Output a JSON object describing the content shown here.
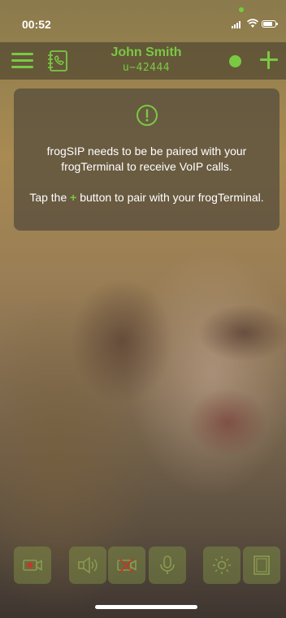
{
  "status_bar": {
    "time": "00:52"
  },
  "header": {
    "user_name": "John Smith",
    "user_id": "u−42444"
  },
  "notice": {
    "line1": "frogSIP needs to be be paired with your frogTerminal to receive VoIP calls.",
    "line2_before": "Tap the",
    "line2_plus": "+",
    "line2_after": "button to pair with your frogTerminal."
  },
  "toolbar": {
    "buttons": [
      {
        "icon": "video-record-icon"
      },
      {
        "icon": "speaker-icon"
      },
      {
        "icon": "video-off-icon"
      },
      {
        "icon": "microphone-icon"
      },
      {
        "icon": "brightness-icon"
      },
      {
        "icon": "door-icon"
      }
    ]
  },
  "colors": {
    "accent": "#7ac943",
    "record": "#c0392b"
  }
}
